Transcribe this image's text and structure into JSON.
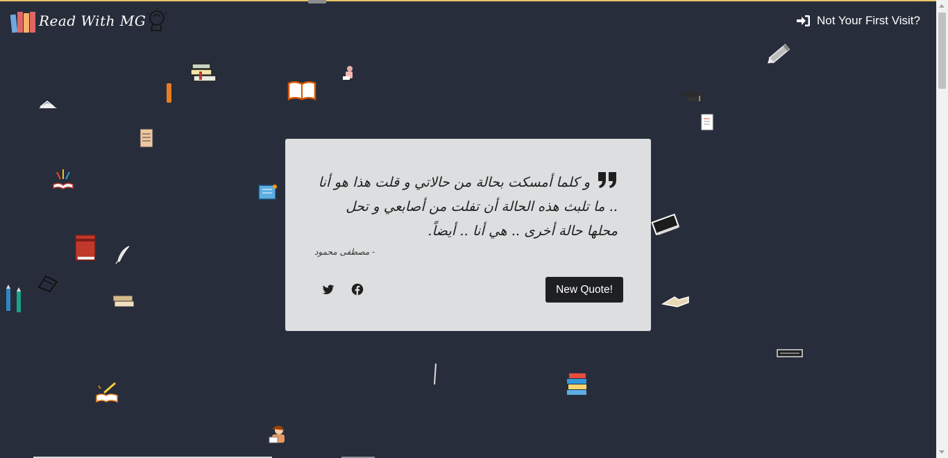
{
  "brand": {
    "name": "Read With MG",
    "accent": "#e9c46a",
    "background": "#282d3b"
  },
  "header": {
    "login_label": "Not Your First Visit?",
    "login_icon": "sign-in-icon"
  },
  "quote_card": {
    "text": "و كلما أمسكت بحالة من حالاتي و قلت هذا هو أنا .. ما تلبث هذه الحالة أن تفلت من أصابعي و تحل محلها حالة أخرى .. هي أنا .. أيضاً.",
    "author": "- مصطفى محمود",
    "quote_icon": "quote-left-icon",
    "twitter_icon": "twitter-icon",
    "facebook_icon": "facebook-icon",
    "new_quote_label": "New Quote!",
    "background": "#dcdedf",
    "button_color": "#1e1f22"
  },
  "decorations": [
    "pencil-icon",
    "book-stack-icon",
    "open-book-icon",
    "graduation-cap-icon",
    "clipboard-icon",
    "notebook-icon",
    "quill-icon",
    "reading-person-icon"
  ]
}
